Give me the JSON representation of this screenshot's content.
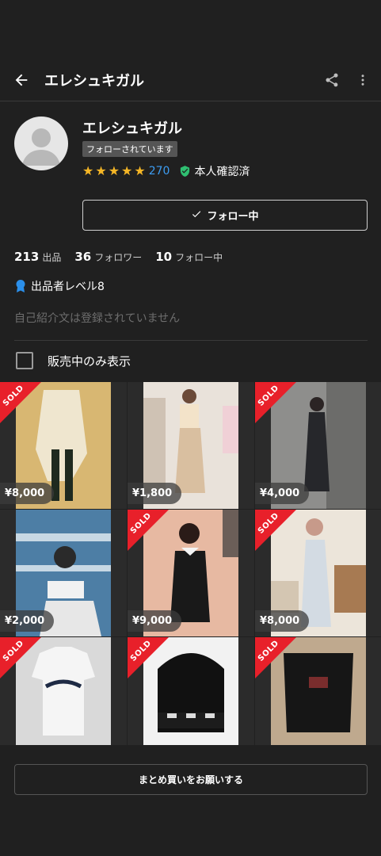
{
  "header": {
    "title": "エレシュキガル"
  },
  "profile": {
    "name": "エレシュキガル",
    "follows_you_badge": "フォローされています",
    "rating_stars": 5,
    "review_count": "270",
    "verified_label": "本人確認済",
    "follow_button_label": "フォロー中"
  },
  "stats": {
    "listings_num": "213",
    "listings_label": "出品",
    "followers_num": "36",
    "followers_label": "フォロワー",
    "following_num": "10",
    "following_label": "フォロー中"
  },
  "seller_level": "出品者レベル8",
  "bio_placeholder": "自己紹介文は登録されていません",
  "filter": {
    "label": "販売中のみ表示",
    "checked": false
  },
  "sold_label": "SOLD",
  "items": [
    {
      "price": "¥8,000",
      "sold": true
    },
    {
      "price": "¥1,800",
      "sold": false
    },
    {
      "price": "¥4,000",
      "sold": true
    },
    {
      "price": "¥2,000",
      "sold": false
    },
    {
      "price": "¥9,000",
      "sold": true
    },
    {
      "price": "¥8,000",
      "sold": true
    },
    {
      "price": "",
      "sold": true
    },
    {
      "price": "",
      "sold": true
    },
    {
      "price": "",
      "sold": true
    }
  ],
  "bulk_button_label": "まとめ買いをお願いする",
  "colors": {
    "background": "#202020",
    "accent_star": "#f5b626",
    "link_blue": "#3d9df2",
    "verified_green": "#2fbf71",
    "sold_red": "#e8202a"
  }
}
